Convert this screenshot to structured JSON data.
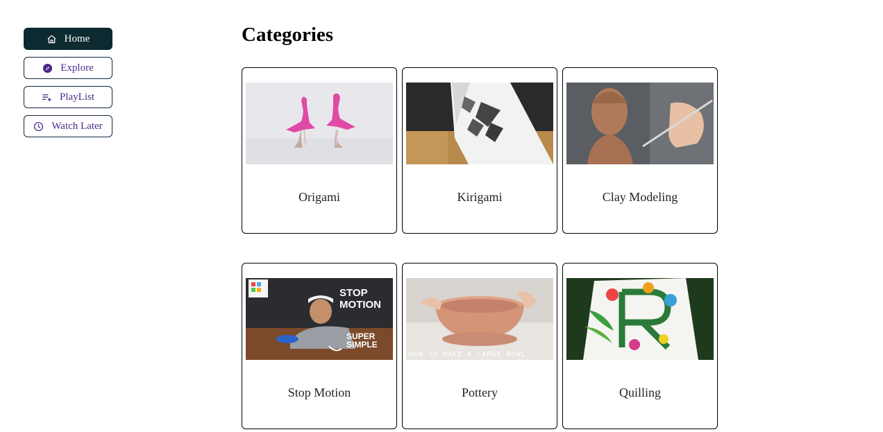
{
  "sidebar": {
    "items": [
      {
        "label": "Home",
        "icon": "home-icon",
        "active": true
      },
      {
        "label": "Explore",
        "icon": "compass-icon",
        "active": false
      },
      {
        "label": "PlayList",
        "icon": "playlist-add-icon",
        "active": false
      },
      {
        "label": "Watch Later",
        "icon": "clock-icon",
        "active": false
      }
    ]
  },
  "main": {
    "title": "Categories",
    "categories": [
      {
        "label": "Origami",
        "image": "pink origami flamingos"
      },
      {
        "label": "Kirigami",
        "image": "white kirigami fractal pop-up"
      },
      {
        "label": "Clay Modeling",
        "image": "sculpting a clay bust"
      },
      {
        "label": "Stop Motion",
        "image": "stop motion thumbnail",
        "image_text": [
          "STOP",
          "MOTION",
          "SUPER",
          "SIMPLE"
        ]
      },
      {
        "label": "Pottery",
        "image": "clay bowl on pottery wheel",
        "image_text": [
          "HOW TO MAKE A LARGE BOWL"
        ]
      },
      {
        "label": "Quilling",
        "image": "colorful paper quilling letter"
      }
    ]
  },
  "colors": {
    "active_bg": "#0c2a2f",
    "nav_text": "#4b2a8a",
    "border": "#12263a"
  }
}
